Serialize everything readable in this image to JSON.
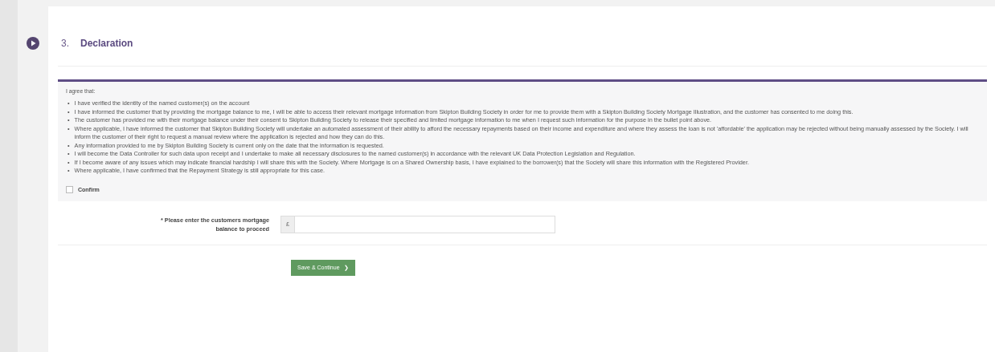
{
  "section": {
    "number": "3.",
    "title": "Declaration"
  },
  "declaration": {
    "intro": "I agree that:",
    "marker": "•",
    "bullets": [
      "I have verified the identity of the named customer(s) on the account",
      "I have informed the customer that by providing the mortgage balance to me, I will be able to access their relevant mortgage information from Skipton Building Society in order for me to provide them with a Skipton Building Society Mortgage Illustration, and the customer has consented to me doing this.",
      "The customer has provided me with their mortgage balance under their consent to Skipton Building Society to release their specified and limited mortgage information to me when I request such information for the purpose in the bullet point above.",
      "Where applicable, I have informed the customer that Skipton Building Society will undertake an automated assessment of their ability to afford the necessary repayments based on their income and expenditure and where they assess the loan is not 'affordable' the application may be rejected without being manually assessed by the Society. I will inform the customer of their right to request a manual review where the application is rejected and how they can do this.",
      "Any information provided to me by Skipton Building Society is current only on the date that the information is requested.",
      "I will become the Data Controller for such data upon receipt and I undertake to make all necessary disclosures to the named customer(s) in accordance with the relevant UK Data Protection Legislation and Regulation.",
      "If I become aware of any issues which may indicate financial hardship I will share this with the Society. Where Mortgage is on a Shared Ownership basis, I have explained to the borrower(s) that the Society will share this information with the Registered Provider.",
      "Where applicable, I have confirmed that the Repayment Strategy is still appropriate for this case."
    ],
    "confirm": {
      "label": "Confirm",
      "checked": false
    }
  },
  "balance_field": {
    "label": "* Please enter the customers mortgage balance to proceed",
    "prefix": "£"
  },
  "button": {
    "label": "Save & Continue",
    "icon": "❯"
  }
}
